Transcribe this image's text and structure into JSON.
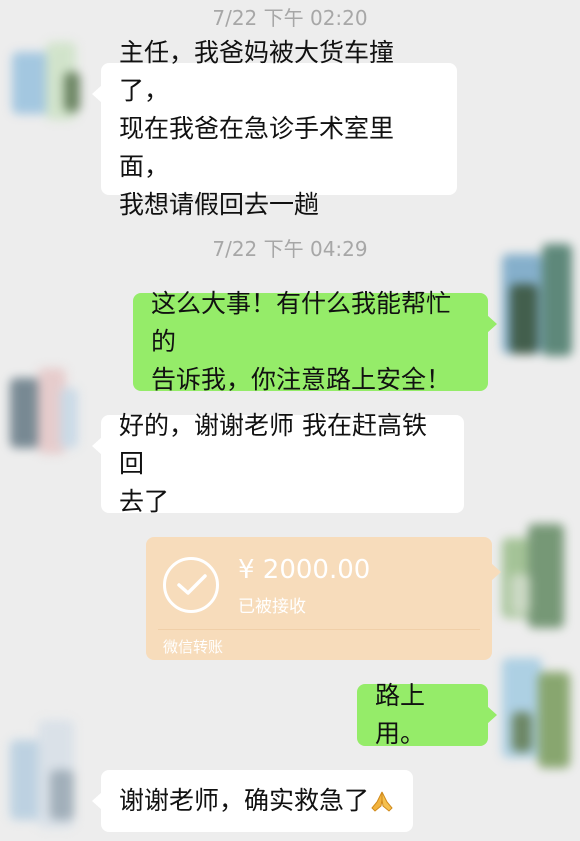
{
  "timestamps": [
    "7/22 下午 02:20",
    "7/22 下午 04:29"
  ],
  "messages": [
    {
      "side": "left",
      "lines": [
        "主任，我爸妈被大货车撞了，",
        "现在我爸在急诊手术室里面，",
        "我想请假回去一趟"
      ]
    },
    {
      "side": "right",
      "lines": [
        "这么大事！有什么我能帮忙的",
        "告诉我，你注意路上安全！"
      ]
    },
    {
      "side": "left",
      "lines": [
        "好的，谢谢老师 我在赶高铁回",
        "去了"
      ]
    },
    {
      "side": "right",
      "lines": [
        "路上用。"
      ]
    },
    {
      "side": "left",
      "lines": [
        "谢谢老师，确实救急了"
      ]
    }
  ],
  "transfer": {
    "amount": "¥ 2000.00",
    "status": "已被接收",
    "label": "微信转账"
  },
  "emoji": "folded-hands-icon",
  "colors": {
    "background": "#ededed",
    "bubble_left": "#ffffff",
    "bubble_right": "#95ec69",
    "transfer_bg": "#f7dcbb",
    "timestamp": "#a7a7a7"
  }
}
